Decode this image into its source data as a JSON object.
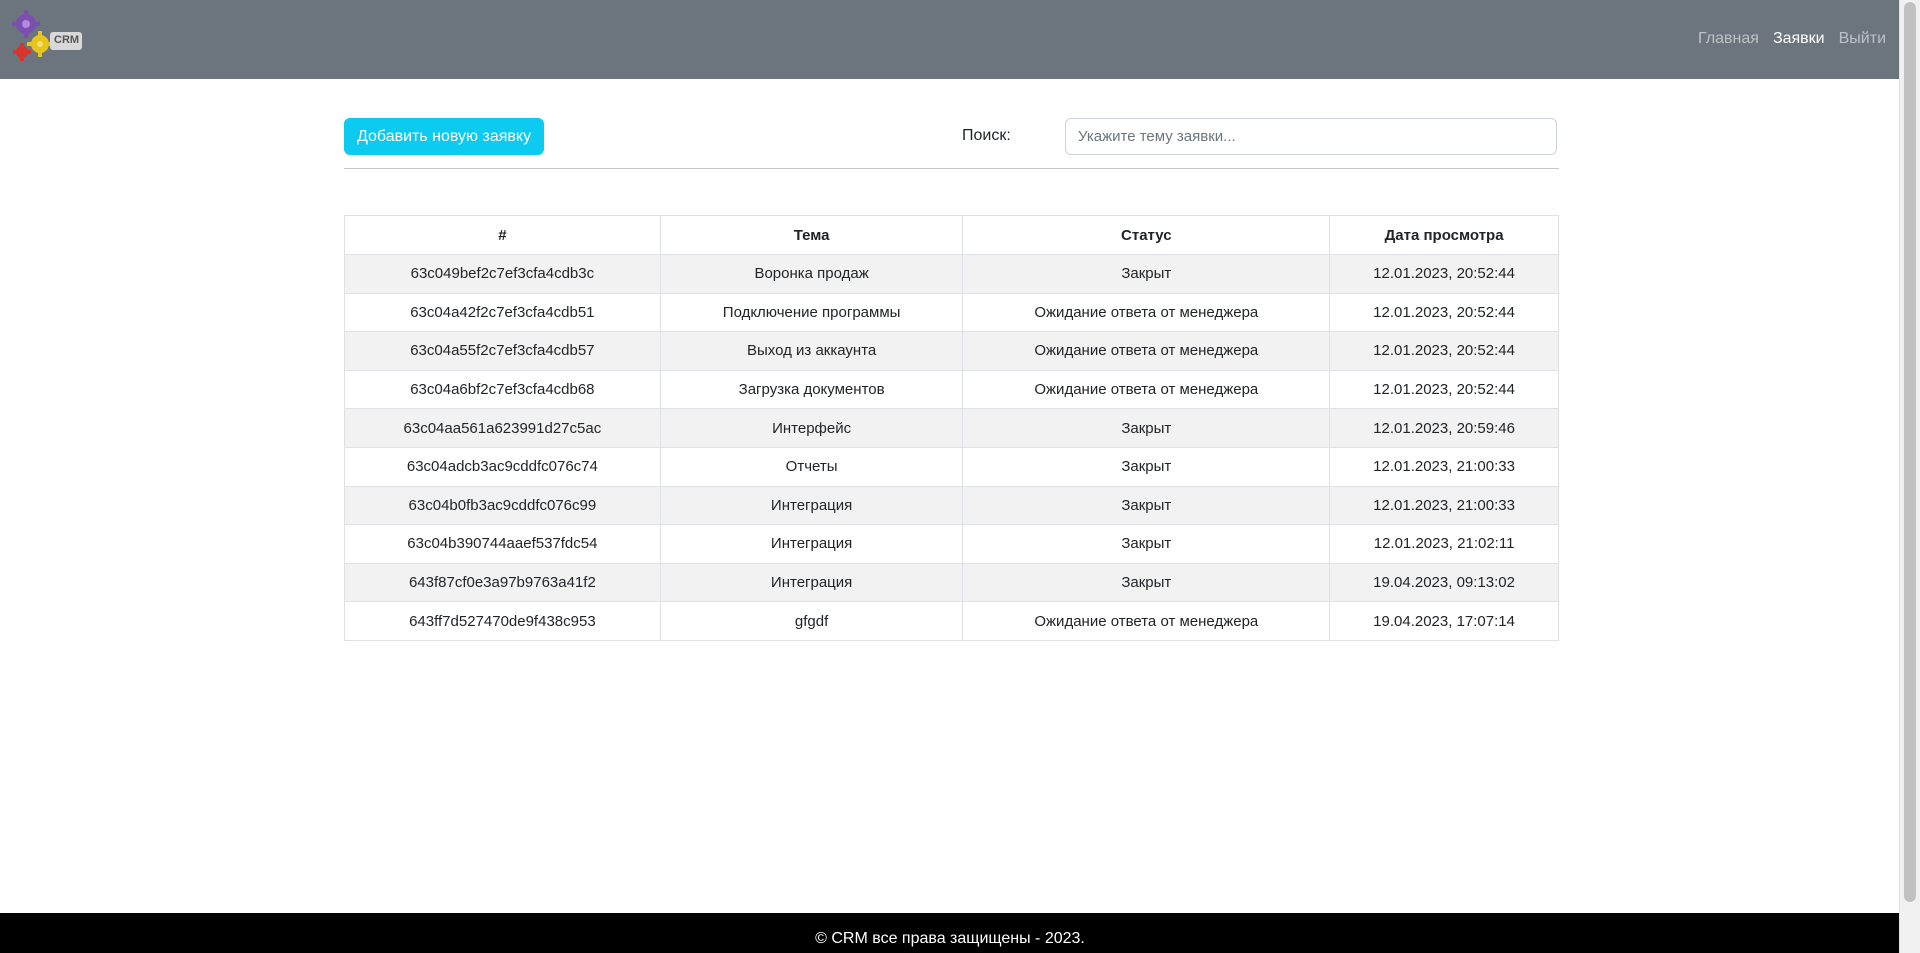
{
  "header": {
    "logo_text": "CRM",
    "nav": [
      {
        "label": "Главная",
        "active": false
      },
      {
        "label": "Заявки",
        "active": true
      },
      {
        "label": "Выйти",
        "active": false
      }
    ]
  },
  "toolbar": {
    "add_button_label": "Добавить новую заявку",
    "search_label": "Поиск:",
    "search_placeholder": "Укажите тему заявки...",
    "search_value": ""
  },
  "table": {
    "columns": [
      "#",
      "Тема",
      "Статус",
      "Дата просмотра"
    ],
    "rows": [
      {
        "id": "63c049bef2c7ef3cfa4cdb3c",
        "topic": "Воронка продаж",
        "status": "Закрыт",
        "date": "12.01.2023, 20:52:44"
      },
      {
        "id": "63c04a42f2c7ef3cfa4cdb51",
        "topic": "Подключение программы",
        "status": "Ожидание ответа от менеджера",
        "date": "12.01.2023, 20:52:44"
      },
      {
        "id": "63c04a55f2c7ef3cfa4cdb57",
        "topic": "Выход из аккаунта",
        "status": "Ожидание ответа от менеджера",
        "date": "12.01.2023, 20:52:44"
      },
      {
        "id": "63c04a6bf2c7ef3cfa4cdb68",
        "topic": "Загрузка документов",
        "status": "Ожидание ответа от менеджера",
        "date": "12.01.2023, 20:52:44"
      },
      {
        "id": "63c04aa561a623991d27c5ac",
        "topic": "Интерфейс",
        "status": "Закрыт",
        "date": "12.01.2023, 20:59:46"
      },
      {
        "id": "63c04adcb3ac9cddfc076c74",
        "topic": "Отчеты",
        "status": "Закрыт",
        "date": "12.01.2023, 21:00:33"
      },
      {
        "id": "63c04b0fb3ac9cddfc076c99",
        "topic": "Интеграция",
        "status": "Закрыт",
        "date": "12.01.2023, 21:00:33"
      },
      {
        "id": "63c04b390744aaef537fdc54",
        "topic": "Интеграция",
        "status": "Закрыт",
        "date": "12.01.2023, 21:02:11"
      },
      {
        "id": "643f87cf0e3a97b9763a41f2",
        "topic": "Интеграция",
        "status": "Закрыт",
        "date": "19.04.2023, 09:13:02"
      },
      {
        "id": "643ff7d527470de9f438c953",
        "topic": "gfgdf",
        "status": "Ожидание ответа от менеджера",
        "date": "19.04.2023, 17:07:14"
      }
    ]
  },
  "footer": {
    "text": "© CRM все права защищены - 2023."
  },
  "colors": {
    "navbar": "#6c757d",
    "primary_button": "#0dcaf0",
    "footer": "#000000"
  }
}
